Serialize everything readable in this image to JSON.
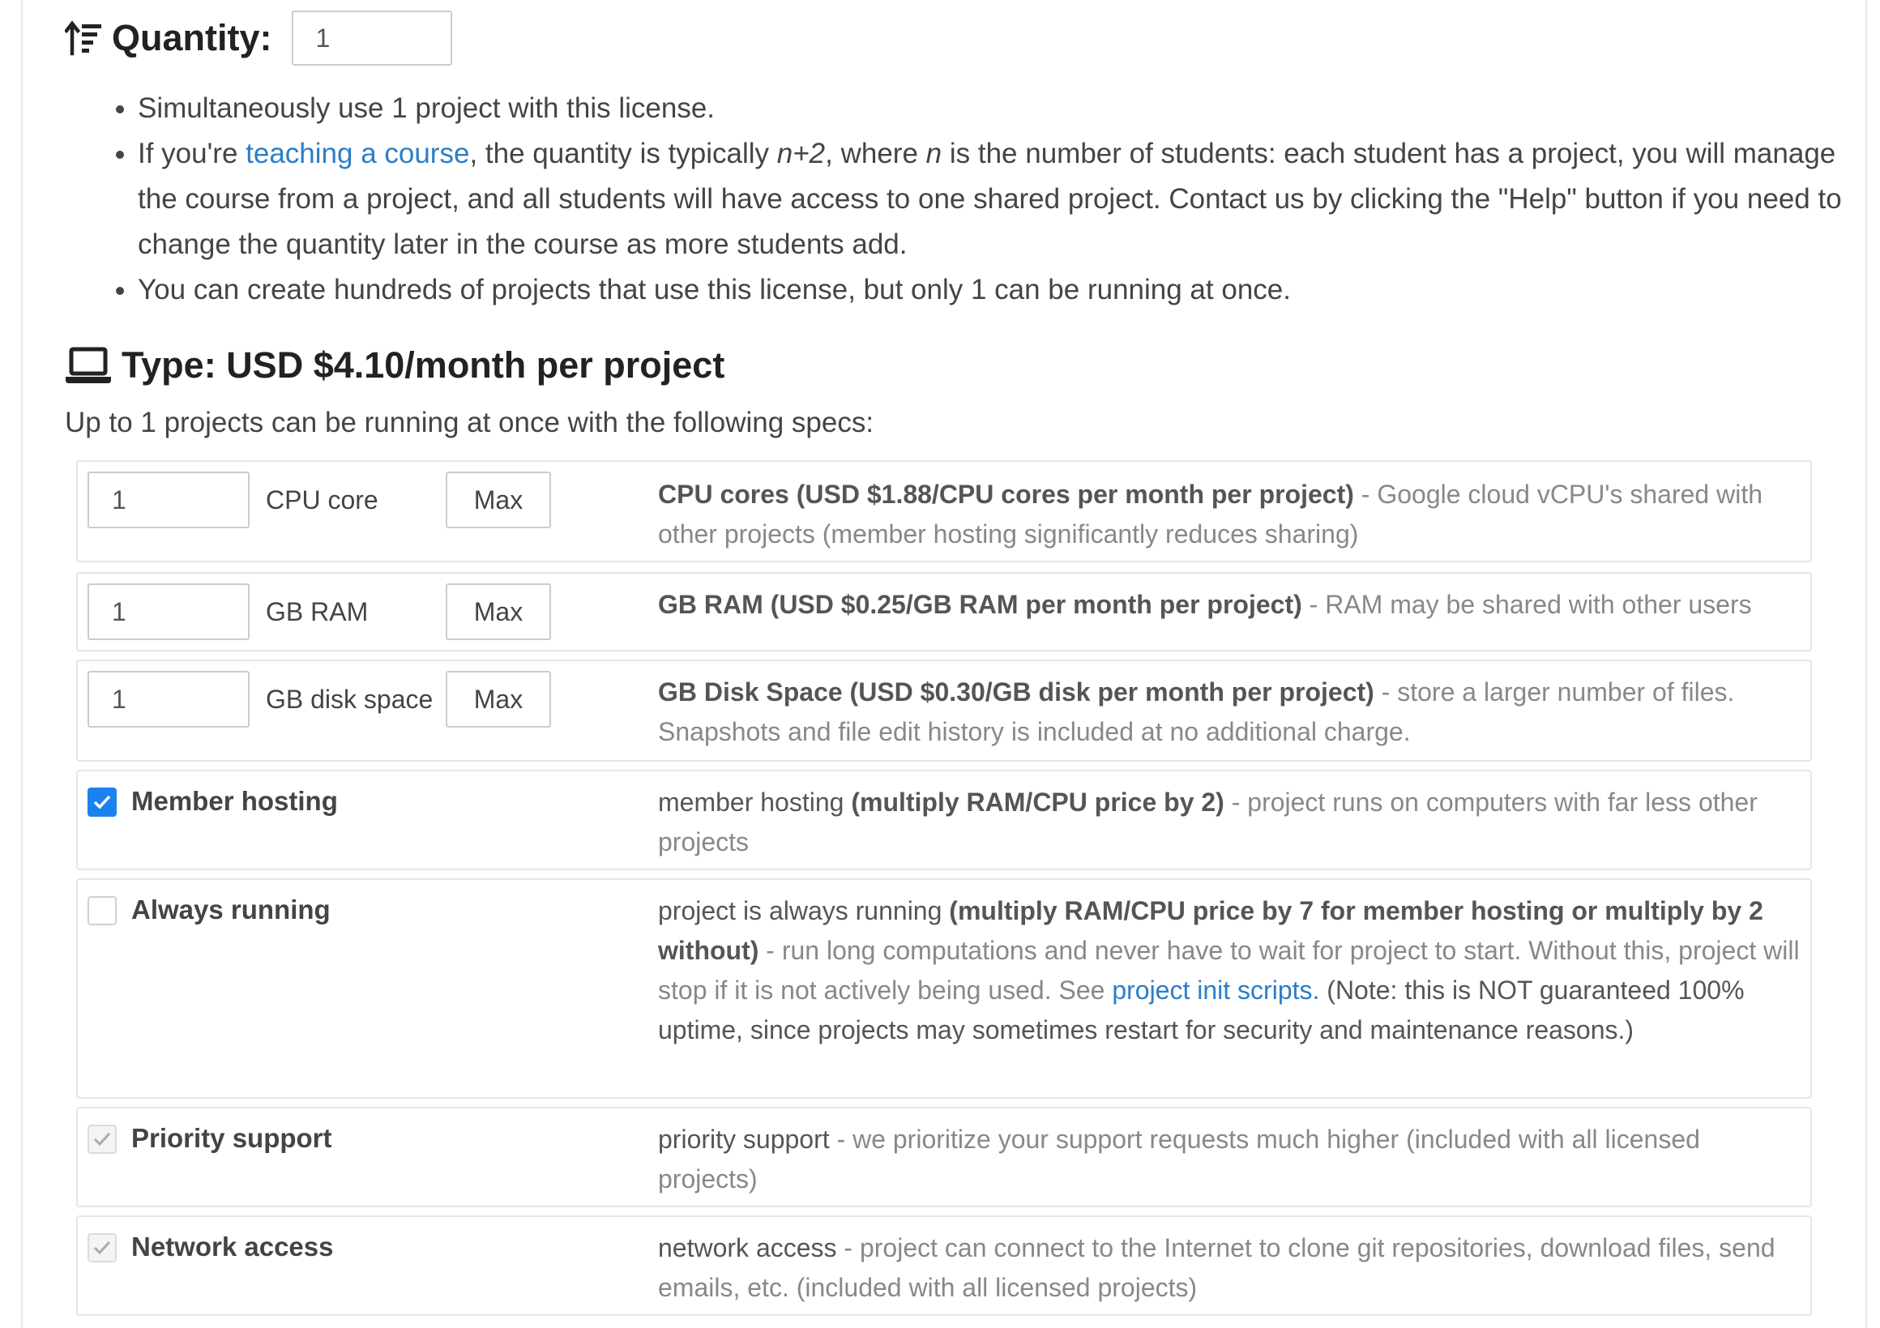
{
  "quantity": {
    "title": "Quantity:",
    "value": "1",
    "bullets": {
      "b1": "Simultaneously use 1 project with this license.",
      "b2_pre": "If you're ",
      "b2_link": "teaching a course",
      "b2_mid1": ", the quantity is typically ",
      "b2_n2": "n+2",
      "b2_mid2": ", where ",
      "b2_n": "n",
      "b2_post": " is the number of students: each student has a project, you will manage the course from a project, and all students will have access to one shared project. Contact us by clicking the \"Help\" button if you need to change the quantity later in the course as more students add.",
      "b3": "You can create hundreds of projects that use this license, but only 1 can be running at once."
    }
  },
  "type": {
    "title": "Type: USD $4.10/month per project",
    "intro": "Up to 1 projects can be running at once with the following specs:"
  },
  "specs": {
    "cpu": {
      "value": "1",
      "unit": "CPU core",
      "max_label": "Max",
      "desc_bold": "CPU cores (USD $1.88/CPU cores per month per project)",
      "desc_rest": " - Google cloud vCPU's shared with other projects (member hosting significantly reduces sharing)"
    },
    "ram": {
      "value": "1",
      "unit": "GB RAM",
      "max_label": "Max",
      "desc_bold": "GB RAM (USD $0.25/GB RAM per month per project)",
      "desc_rest": " - RAM may be shared with other users"
    },
    "disk": {
      "value": "1",
      "unit": "GB disk space",
      "max_label": "Max",
      "desc_bold": "GB Disk Space (USD $0.30/GB disk per month per project)",
      "desc_rest": " - store a larger number of files. Snapshots and file edit history is included at no additional charge."
    }
  },
  "options": {
    "member": {
      "label": "Member hosting",
      "checked": true,
      "desc_plain": "member hosting ",
      "desc_bold": "(multiply RAM/CPU price by 2)",
      "desc_rest": " - project runs on computers with far less other projects"
    },
    "always": {
      "label": "Always running",
      "checked": false,
      "desc_plain": "project is always running ",
      "desc_bold": "(multiply RAM/CPU price by 7 for member hosting or multiply by 2 without)",
      "desc_rest": " - run long computations and never have to wait for project to start. Without this, project will stop if it is not actively being used. See ",
      "desc_link": "project init scripts.",
      "desc_tail": " (Note: this is NOT guaranteed 100% uptime, since projects may sometimes restart for security and maintenance reasons.)"
    },
    "priority": {
      "label": "Priority support",
      "checked": true,
      "disabled": true,
      "desc_plain": "priority support",
      "desc_rest": " - we prioritize your support requests much higher (included with all licensed projects)"
    },
    "network": {
      "label": "Network access",
      "checked": true,
      "disabled": true,
      "desc_plain": "network access",
      "desc_rest": " - project can connect to the Internet to clone git repositories, download files, send emails, etc. (included with all licensed projects)"
    }
  },
  "colors": {
    "link": "#2a7ec9",
    "checkbox_checked": "#1a82f0",
    "border": "#e6e6e6"
  },
  "icons": {
    "quantity": "sort-amount-up-icon",
    "type": "laptop-icon",
    "check": "check-icon"
  }
}
